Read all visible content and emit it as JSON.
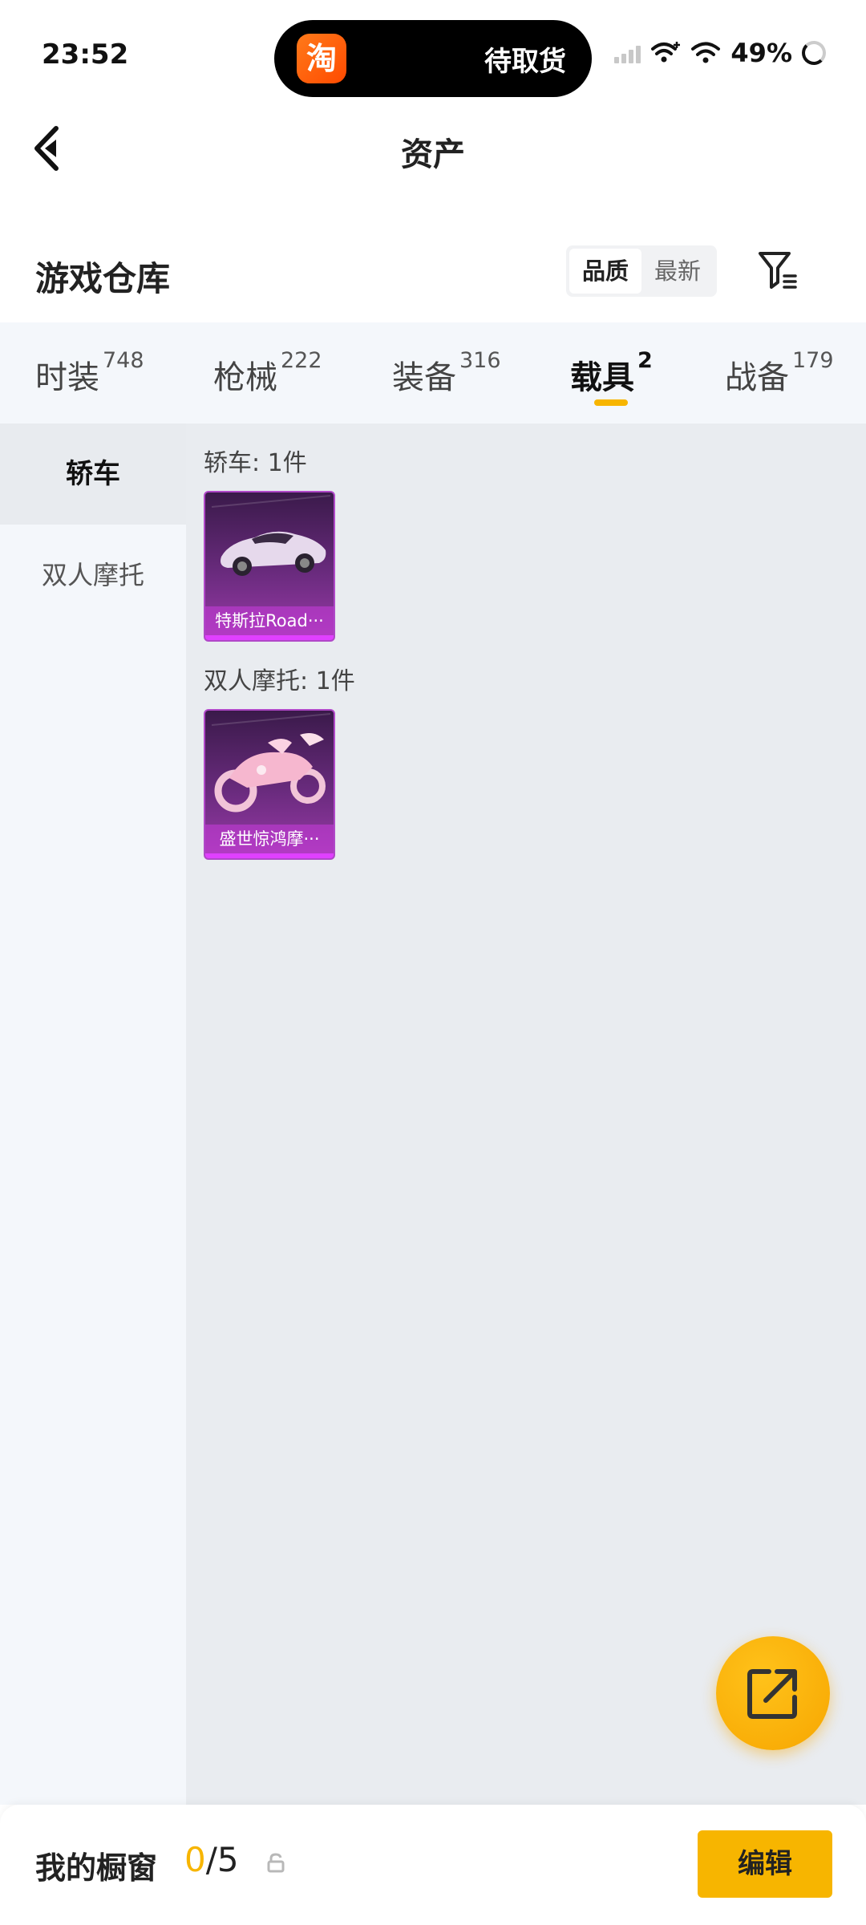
{
  "status_bar": {
    "time": "23:52",
    "island_app_icon": "淘",
    "island_text": "待取货",
    "battery": "49%"
  },
  "header": {
    "title": "资产"
  },
  "section": {
    "title": "游戏仓库",
    "sort_options": [
      "品质",
      "最新"
    ],
    "sort_selected": "品质"
  },
  "tabs": [
    {
      "label": "时装",
      "count": "748"
    },
    {
      "label": "枪械",
      "count": "222"
    },
    {
      "label": "装备",
      "count": "316"
    },
    {
      "label": "载具",
      "count": "2"
    },
    {
      "label": "战备",
      "count": "179"
    }
  ],
  "active_tab": "载具",
  "sidebar": {
    "items": [
      "轿车",
      "双人摩托"
    ],
    "active": "轿车"
  },
  "groups": [
    {
      "label": "轿车: 1件",
      "items": [
        {
          "name": "特斯拉Road···"
        }
      ]
    },
    {
      "label": "双人摩托: 1件",
      "items": [
        {
          "name": "盛世惊鸿摩···"
        }
      ]
    }
  ],
  "bottom_bar": {
    "label": "我的橱窗",
    "current": "0",
    "total": "/5",
    "edit_label": "编辑"
  },
  "colors": {
    "accent": "#f7b500",
    "card_purple": "#6a2b7e"
  }
}
